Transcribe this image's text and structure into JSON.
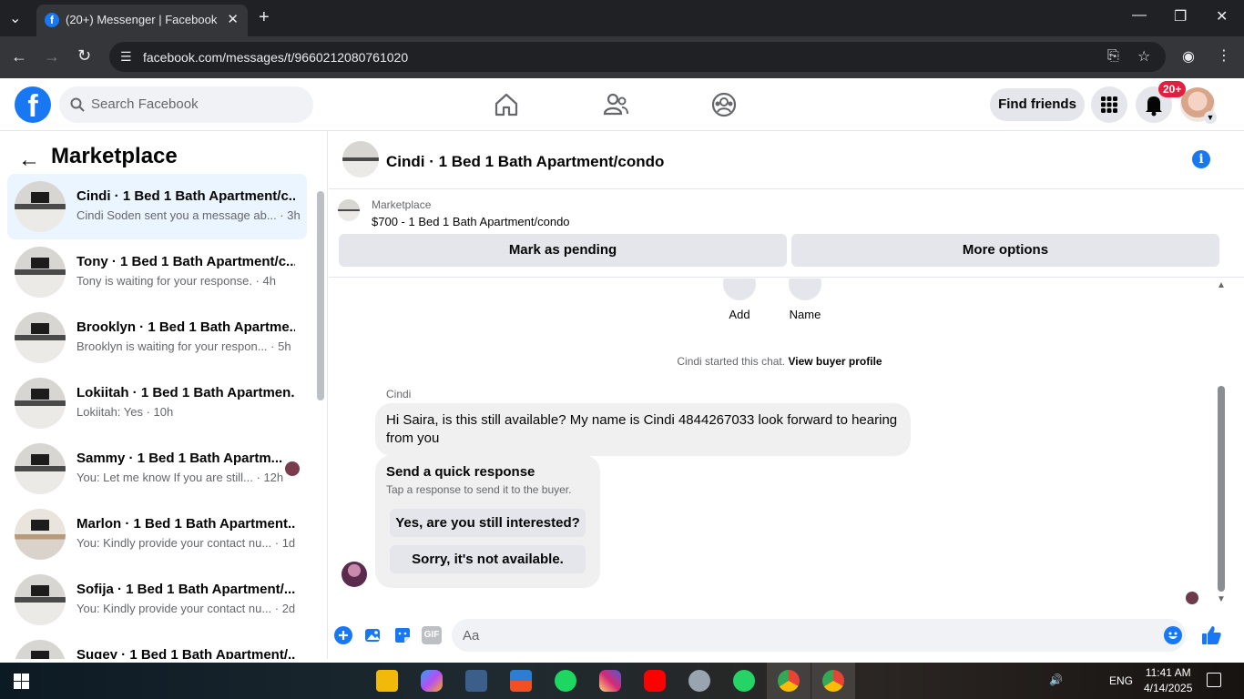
{
  "browser": {
    "tab_title": "(20+) Messenger | Facebook",
    "url": "facebook.com/messages/t/9660212080761020"
  },
  "facebook": {
    "search_placeholder": "Search Facebook",
    "find_friends": "Find friends",
    "notifications_badge": "20+"
  },
  "sidebar": {
    "title": "Marketplace",
    "conversations": [
      {
        "name": "Cindi · 1 Bed 1 Bath Apartment/c...",
        "snippet": "Cindi Soden sent you a message ab... · 3h",
        "active": true
      },
      {
        "name": "Tony · 1 Bed 1 Bath Apartment/c...",
        "snippet": "Tony is waiting for your response. · 4h"
      },
      {
        "name": "Brooklyn · 1 Bed 1 Bath Apartme...",
        "snippet": "Brooklyn is waiting for your respon... · 5h"
      },
      {
        "name": "Lokiitah · 1 Bed 1 Bath Apartmen...",
        "snippet": "Lokiitah: Yes · 10h"
      },
      {
        "name": "Sammy · 1 Bed 1 Bath Apartm...",
        "snippet": "You: Let me know If you are still... · 12h"
      },
      {
        "name": "Marlon · 1 Bed 1 Bath Apartment...",
        "snippet": "You: Kindly provide your contact nu... · 1d"
      },
      {
        "name": "Sofija · 1 Bed 1 Bath Apartment/...",
        "snippet": "You: Kindly provide your contact nu... · 2d"
      },
      {
        "name": "Sugey · 1 Bed 1 Bath Apartment/...",
        "snippet": ""
      }
    ]
  },
  "chat": {
    "title": "Cindi · 1 Bed 1 Bath Apartment/condo",
    "listing_source": "Marketplace",
    "listing_price": "$700 - 1 Bed 1 Bath Apartment/condo",
    "mark_pending": "Mark as pending",
    "more_options": "More options",
    "add_label": "Add",
    "name_label": "Name",
    "started_text": "Cindi started this chat.",
    "view_profile": "View buyer profile",
    "sender": "Cindi",
    "message": "Hi Saira, is this still available? My name is Cindi 4844267033 look forward to hearing from you",
    "quick_title": "Send a quick response",
    "quick_subtitle": "Tap a response to send it to the buyer.",
    "quick_reply_1": "Yes, are you still interested?",
    "quick_reply_2": "Sorry, it's not available.",
    "input_placeholder": "Aa"
  },
  "taskbar": {
    "time": "11:41 AM",
    "date": "4/14/2025",
    "lang": "ENG"
  },
  "colors": {
    "facebook_blue": "#1877f2",
    "badge_red": "#e41e3f"
  }
}
